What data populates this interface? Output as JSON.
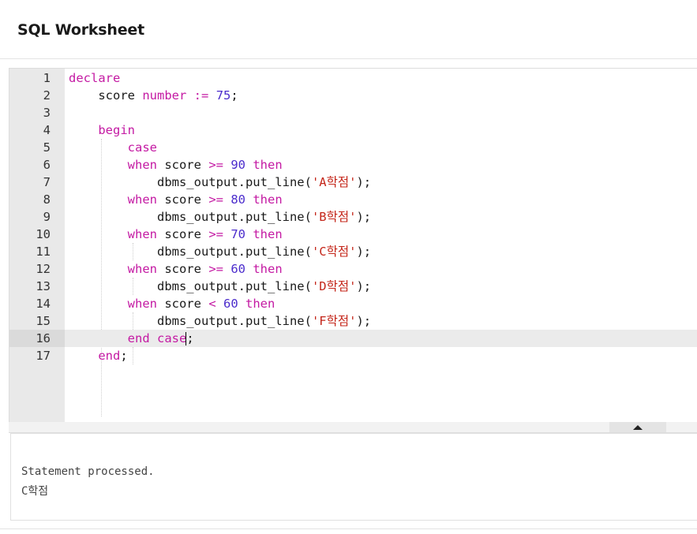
{
  "header": {
    "title": "SQL Worksheet"
  },
  "editor": {
    "active_line": 16,
    "lines": [
      {
        "num": "1",
        "parts": [
          [
            "kw",
            "declare"
          ]
        ]
      },
      {
        "num": "2",
        "parts": [
          [
            "t",
            "    score "
          ],
          [
            "kw",
            "number"
          ],
          [
            "t",
            " "
          ],
          [
            "kw",
            ":="
          ],
          [
            "t",
            " "
          ],
          [
            "num",
            "75"
          ],
          [
            "t",
            ";"
          ]
        ]
      },
      {
        "num": "3",
        "parts": []
      },
      {
        "num": "4",
        "parts": [
          [
            "t",
            "    "
          ],
          [
            "kw",
            "begin"
          ]
        ]
      },
      {
        "num": "5",
        "parts": [
          [
            "t",
            "        "
          ],
          [
            "kw",
            "case"
          ]
        ]
      },
      {
        "num": "6",
        "parts": [
          [
            "t",
            "        "
          ],
          [
            "kw",
            "when"
          ],
          [
            "t",
            " score "
          ],
          [
            "kw",
            ">="
          ],
          [
            "t",
            " "
          ],
          [
            "num",
            "90"
          ],
          [
            "t",
            " "
          ],
          [
            "kw",
            "then"
          ]
        ]
      },
      {
        "num": "7",
        "parts": [
          [
            "t",
            "            dbms_output.put_line("
          ],
          [
            "str",
            "'A학점'"
          ],
          [
            "t",
            ");"
          ]
        ]
      },
      {
        "num": "8",
        "parts": [
          [
            "t",
            "        "
          ],
          [
            "kw",
            "when"
          ],
          [
            "t",
            " score "
          ],
          [
            "kw",
            ">="
          ],
          [
            "t",
            " "
          ],
          [
            "num",
            "80"
          ],
          [
            "t",
            " "
          ],
          [
            "kw",
            "then"
          ]
        ]
      },
      {
        "num": "9",
        "parts": [
          [
            "t",
            "            dbms_output.put_line("
          ],
          [
            "str",
            "'B학점'"
          ],
          [
            "t",
            ");"
          ]
        ]
      },
      {
        "num": "10",
        "parts": [
          [
            "t",
            "        "
          ],
          [
            "kw",
            "when"
          ],
          [
            "t",
            " score "
          ],
          [
            "kw",
            ">="
          ],
          [
            "t",
            " "
          ],
          [
            "num",
            "70"
          ],
          [
            "t",
            " "
          ],
          [
            "kw",
            "then"
          ]
        ]
      },
      {
        "num": "11",
        "parts": [
          [
            "t",
            "            dbms_output.put_line("
          ],
          [
            "str",
            "'C학점'"
          ],
          [
            "t",
            ");"
          ]
        ]
      },
      {
        "num": "12",
        "parts": [
          [
            "t",
            "        "
          ],
          [
            "kw",
            "when"
          ],
          [
            "t",
            " score "
          ],
          [
            "kw",
            ">="
          ],
          [
            "t",
            " "
          ],
          [
            "num",
            "60"
          ],
          [
            "t",
            " "
          ],
          [
            "kw",
            "then"
          ]
        ]
      },
      {
        "num": "13",
        "parts": [
          [
            "t",
            "            dbms_output.put_line("
          ],
          [
            "str",
            "'D학점'"
          ],
          [
            "t",
            ");"
          ]
        ]
      },
      {
        "num": "14",
        "parts": [
          [
            "t",
            "        "
          ],
          [
            "kw",
            "when"
          ],
          [
            "t",
            " score "
          ],
          [
            "kw",
            "<"
          ],
          [
            "t",
            " "
          ],
          [
            "num",
            "60"
          ],
          [
            "t",
            " "
          ],
          [
            "kw",
            "then"
          ]
        ]
      },
      {
        "num": "15",
        "parts": [
          [
            "t",
            "            dbms_output.put_line("
          ],
          [
            "str",
            "'F학점'"
          ],
          [
            "t",
            ");"
          ]
        ]
      },
      {
        "num": "16",
        "parts": [
          [
            "t",
            "        "
          ],
          [
            "kw",
            "end"
          ],
          [
            "t",
            " "
          ],
          [
            "kw",
            "case"
          ],
          [
            "caret",
            ""
          ],
          [
            "t",
            ";"
          ]
        ]
      },
      {
        "num": "17",
        "parts": [
          [
            "t",
            "    "
          ],
          [
            "kw",
            "end"
          ],
          [
            "t",
            ";"
          ]
        ]
      }
    ]
  },
  "output": {
    "status": "Statement processed.",
    "result": "C학점"
  }
}
